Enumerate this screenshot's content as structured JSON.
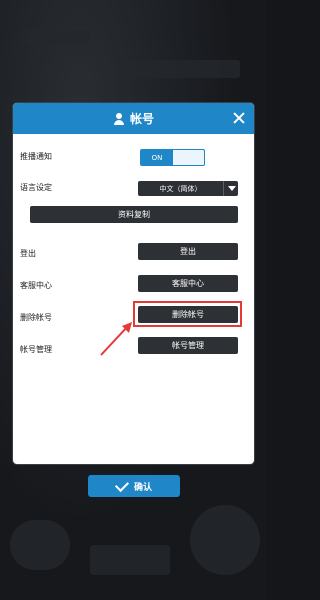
{
  "dialog": {
    "title": "帐号",
    "close_icon": "close-icon",
    "user_icon": "user-icon"
  },
  "push": {
    "label": "推播通知",
    "toggle": "ON"
  },
  "language": {
    "label": "语言设定",
    "value": "中文（简体）"
  },
  "copy": {
    "label": "资料复制"
  },
  "logout": {
    "label": "登出",
    "button": "登出"
  },
  "support": {
    "label": "客服中心",
    "button": "客服中心"
  },
  "delete": {
    "label": "删除帐号",
    "button": "删除帐号"
  },
  "manage": {
    "label": "帐号管理",
    "button": "帐号管理"
  },
  "confirm": {
    "label": "确认"
  },
  "colors": {
    "accent": "#1f86c7",
    "dark_button": "#2d3136",
    "highlight": "#e53935"
  }
}
